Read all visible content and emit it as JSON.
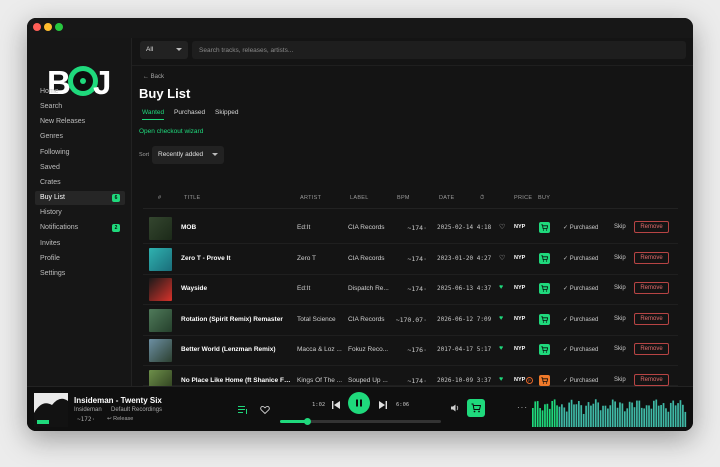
{
  "window": {
    "search_scope": "All",
    "search_placeholder": "Search tracks, releases, artists..."
  },
  "sidebar": {
    "logo_text": "BDJ",
    "items": [
      {
        "label": "Home"
      },
      {
        "label": "Search"
      },
      {
        "label": "New Releases"
      },
      {
        "label": "Genres"
      },
      {
        "label": "Following"
      },
      {
        "label": "Saved"
      },
      {
        "label": "Crates"
      },
      {
        "label": "Buy List",
        "badge": "6",
        "active": true
      },
      {
        "label": "History"
      },
      {
        "label": "Notifications",
        "badge": "2"
      },
      {
        "label": "Invites"
      },
      {
        "label": "Profile"
      },
      {
        "label": "Settings"
      }
    ]
  },
  "page": {
    "back": "← Back",
    "title": "Buy List",
    "tabs": [
      "Wanted",
      "Purchased",
      "Skipped"
    ],
    "checkout": "Open checkout wizard",
    "sort_label": "Sort",
    "sort_value": "Recently added"
  },
  "table": {
    "headers": [
      "#",
      "TITLE",
      "ARTIST",
      "LABEL",
      "BPM",
      "DATE",
      "⏱",
      "PRICE",
      "BUY"
    ],
    "rows": [
      {
        "title": "MOB",
        "artist": "Ed:It",
        "label": "CIA Records",
        "bpm": "~174·",
        "date": "2025-02-14",
        "length": "4:18",
        "liked": false,
        "price": "NYP",
        "extra": "",
        "buy_color": "green",
        "status": "✓ Purchased",
        "skip": "Skip",
        "remove": "Remove",
        "art": [
          "#34462f",
          "#1c2a19"
        ]
      },
      {
        "title": "Zero T - Prove It",
        "artist": "Zero T",
        "label": "CIA Records",
        "bpm": "~174·",
        "date": "2023-01-20",
        "length": "4:27",
        "liked": false,
        "price": "NYP",
        "extra": "",
        "buy_color": "green",
        "status": "✓ Purchased",
        "skip": "Skip",
        "remove": "Remove",
        "art": [
          "#2fb2b0",
          "#1a6d7a"
        ]
      },
      {
        "title": "Wayside",
        "artist": "Ed:It",
        "label": "Dispatch Re...",
        "bpm": "~174·",
        "date": "2025-06-13",
        "length": "4:37",
        "liked": true,
        "price": "NYP",
        "extra": "",
        "buy_color": "green",
        "status": "✓ Purchased",
        "skip": "Skip",
        "remove": "Remove",
        "art": [
          "#1a1a1a",
          "#d8322a"
        ]
      },
      {
        "title": "Rotation (Spirit Remix) Remaster",
        "artist": "Total Science",
        "label": "CIA Records",
        "bpm": "~170.07·",
        "date": "2026-06-12",
        "length": "7:09",
        "liked": true,
        "price": "NYP",
        "extra": "",
        "buy_color": "green",
        "status": "✓ Purchased",
        "skip": "Skip",
        "remove": "Remove",
        "art": [
          "#4f7a5a",
          "#25402c"
        ]
      },
      {
        "title": "Better World (Lenzman Remix)",
        "artist": "Macca & Loz ...",
        "label": "Fokuz Reco...",
        "bpm": "~176·",
        "date": "2017-04-17",
        "length": "5:17",
        "liked": true,
        "price": "NYP",
        "extra": "",
        "buy_color": "green",
        "status": "✓ Purchased",
        "skip": "Skip",
        "remove": "Remove",
        "art": [
          "#6c8fa3",
          "#2c4030"
        ]
      },
      {
        "title": "No Place Like Home (ft Shanice Fo...",
        "artist": "Kings Of The ...",
        "label": "Souped Up ...",
        "bpm": "~174·",
        "date": "2026-10-09",
        "length": "3:37",
        "liked": true,
        "price": "NYP",
        "extra": "P",
        "buy_color": "orange",
        "status": "✓ Purchased",
        "skip": "Skip",
        "remove": "Remove",
        "art": [
          "#6d8f4a",
          "#2a3a1c"
        ]
      }
    ]
  },
  "player": {
    "title": "Insideman - Twenty Six",
    "artist": "Insideman",
    "label": "Default Recordings",
    "bpm": "~172·",
    "release": "↩ Release",
    "elapsed": "1:02",
    "duration": "6:06",
    "progress": 0.17
  },
  "colors": {
    "accent": "#1fd97c",
    "danger": "#b74444",
    "orange": "#f07a2a"
  }
}
